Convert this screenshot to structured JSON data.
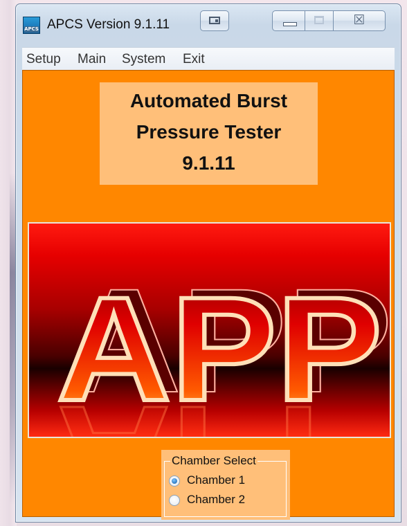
{
  "window": {
    "title": "APCS Version 9.1.11",
    "icon_name": "apcs-app-icon",
    "icon_caption": "APCS",
    "controls": [
      "extra-title-icon",
      "minimize-icon",
      "maximize-icon",
      "close-icon"
    ],
    "close_glyph": "☒"
  },
  "menu": {
    "items": [
      {
        "label": "Setup"
      },
      {
        "label": "Main"
      },
      {
        "label": "System"
      },
      {
        "label": "Exit"
      }
    ]
  },
  "main": {
    "title_lines": [
      "Automated Burst",
      "Pressure Tester",
      "9.1.11"
    ],
    "logo_text": "APP",
    "chamber_select": {
      "legend": "Chamber Select",
      "options": [
        {
          "label": "Chamber 1",
          "checked": true
        },
        {
          "label": "Chamber 2",
          "checked": false
        }
      ]
    }
  },
  "colors": {
    "client_background": "#ff8700",
    "panel_background": "#ffbf79",
    "logo_red": "#ff1a10",
    "logo_dark": "#190000"
  }
}
